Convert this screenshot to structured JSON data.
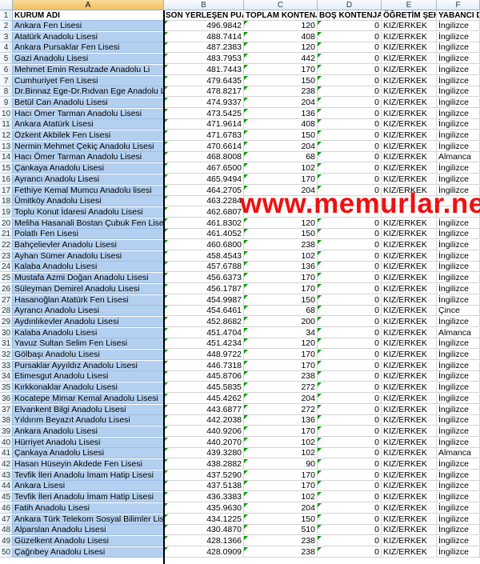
{
  "columns": [
    "A",
    "B",
    "C",
    "D",
    "E",
    "F"
  ],
  "headers": [
    "KURUM ADI",
    "SON YERLEŞEN PUANI",
    "TOPLAM KONTENJAN",
    "BOŞ KONTENJAN",
    "ÖĞRETİM ŞEKLİ",
    "YABANCI DİL"
  ],
  "watermark": "www.memurlar.net",
  "rows": [
    {
      "n": "2",
      "name": "Ankara Fen Lisesi",
      "puan": "496.9842",
      "toplam": "120",
      "bos": "0",
      "sekil": "KIZ/ERKEK",
      "dil": "İngilizce"
    },
    {
      "n": "3",
      "name": "Atatürk Anadolu Lisesi",
      "puan": "488.7414",
      "toplam": "408",
      "bos": "0",
      "sekil": "KIZ/ERKEK",
      "dil": "İngilizce"
    },
    {
      "n": "4",
      "name": "Ankara Pursaklar Fen Lisesi",
      "puan": "487.2383",
      "toplam": "120",
      "bos": "0",
      "sekil": "KIZ/ERKEK",
      "dil": "İngilizce"
    },
    {
      "n": "5",
      "name": "Gazi Anadolu Lisesi",
      "puan": "483.7953",
      "toplam": "442",
      "bos": "0",
      "sekil": "KIZ/ERKEK",
      "dil": "İngilizce"
    },
    {
      "n": "6",
      "name": "Mehmet Emin Resulzade Anadolu Li",
      "puan": "481.7443",
      "toplam": "170",
      "bos": "0",
      "sekil": "KIZ/ERKEK",
      "dil": "İngilizce"
    },
    {
      "n": "7",
      "name": "Cumhuriyet Fen Lisesi",
      "puan": "479.6435",
      "toplam": "150",
      "bos": "0",
      "sekil": "KIZ/ERKEK",
      "dil": "İngilizce"
    },
    {
      "n": "8",
      "name": "Dr.Binnaz Ege-Dr.Rıdvan Ege Anadolu Lis",
      "puan": "478.8217",
      "toplam": "238",
      "bos": "0",
      "sekil": "KIZ/ERKEK",
      "dil": "İngilizce"
    },
    {
      "n": "9",
      "name": "Betül Can Anadolu Lisesi",
      "puan": "474.9337",
      "toplam": "204",
      "bos": "0",
      "sekil": "KIZ/ERKEK",
      "dil": "İngilizce"
    },
    {
      "n": "10",
      "name": "Hacı Ömer Tarman Anadolu Lisesi",
      "puan": "473.5425",
      "toplam": "136",
      "bos": "0",
      "sekil": "KIZ/ERKEK",
      "dil": "İngilizce"
    },
    {
      "n": "11",
      "name": "Ankara Atatürk Lisesi",
      "puan": "471.9614",
      "toplam": "408",
      "bos": "0",
      "sekil": "KIZ/ERKEK",
      "dil": "İngilizce"
    },
    {
      "n": "12",
      "name": "Özkent Akbilek Fen Lisesi",
      "puan": "471.6783",
      "toplam": "150",
      "bos": "0",
      "sekil": "KIZ/ERKEK",
      "dil": "İngilizce"
    },
    {
      "n": "13",
      "name": "Nermin Mehmet Çekiç Anadolu Lisesi",
      "puan": "470.6614",
      "toplam": "204",
      "bos": "0",
      "sekil": "KIZ/ERKEK",
      "dil": "İngilizce"
    },
    {
      "n": "14",
      "name": "Hacı Ömer Tarman Anadolu Lisesi",
      "puan": "468.8008",
      "toplam": "68",
      "bos": "0",
      "sekil": "KIZ/ERKEK",
      "dil": "Almanca"
    },
    {
      "n": "15",
      "name": "Çankaya Anadolu Lisesi",
      "puan": "467.6500",
      "toplam": "102",
      "bos": "0",
      "sekil": "KIZ/ERKEK",
      "dil": "İngilizce"
    },
    {
      "n": "16",
      "name": "Ayrancı Anadolu Lisesi",
      "puan": "465.9494",
      "toplam": "170",
      "bos": "0",
      "sekil": "KIZ/ERKEK",
      "dil": "İngilizce"
    },
    {
      "n": "17",
      "name": "Fethiye Kemal Mumcu Anadolu lisesi",
      "puan": "464.2705",
      "toplam": "204",
      "bos": "0",
      "sekil": "KIZ/ERKEK",
      "dil": "İngilizce"
    },
    {
      "n": "18",
      "name": "Ümitköy Anadolu Lisesi",
      "puan": "463.2284",
      "toplam": "",
      "bos": "",
      "sekil": "",
      "dil": ""
    },
    {
      "n": "19",
      "name": "Toplu Konut İdaresi Anadolu Lisesi",
      "puan": "462.6807",
      "toplam": "",
      "bos": "",
      "sekil": "",
      "dil": ""
    },
    {
      "n": "20",
      "name": "Meliha Hasanali Bostan Çubuk Fen Lise",
      "puan": "461.8302",
      "toplam": "120",
      "bos": "0",
      "sekil": "KIZ/ERKEK",
      "dil": "İngilizce"
    },
    {
      "n": "21",
      "name": "Polatlı Fen Lisesi",
      "puan": "461.4052",
      "toplam": "150",
      "bos": "0",
      "sekil": "KIZ/ERKEK",
      "dil": "İngilizce"
    },
    {
      "n": "22",
      "name": "Bahçelievler Anadolu Lisesi",
      "puan": "460.6800",
      "toplam": "238",
      "bos": "0",
      "sekil": "KIZ/ERKEK",
      "dil": "İngilizce"
    },
    {
      "n": "23",
      "name": "Ayhan Sümer Anadolu Lisesi",
      "puan": "458.4543",
      "toplam": "102",
      "bos": "0",
      "sekil": "KIZ/ERKEK",
      "dil": "İngilizce"
    },
    {
      "n": "24",
      "name": "Kalaba Anadolu Lisesi",
      "puan": "457.6788",
      "toplam": "136",
      "bos": "0",
      "sekil": "KIZ/ERKEK",
      "dil": "İngilizce"
    },
    {
      "n": "25",
      "name": "Mustafa Azmi Doğan Anadolu Lisesi",
      "puan": "456.6373",
      "toplam": "170",
      "bos": "0",
      "sekil": "KIZ/ERKEK",
      "dil": "İngilizce"
    },
    {
      "n": "26",
      "name": "Süleyman Demirel Anadolu Lisesi",
      "puan": "456.1787",
      "toplam": "170",
      "bos": "0",
      "sekil": "KIZ/ERKEK",
      "dil": "İngilizce"
    },
    {
      "n": "27",
      "name": "Hasanoğlan Atatürk Fen Lisesi",
      "puan": "454.9987",
      "toplam": "150",
      "bos": "0",
      "sekil": "KIZ/ERKEK",
      "dil": "İngilizce"
    },
    {
      "n": "28",
      "name": "Ayrancı Anadolu Lisesi",
      "puan": "454.6461",
      "toplam": "68",
      "bos": "0",
      "sekil": "KIZ/ERKEK",
      "dil": "Çince"
    },
    {
      "n": "29",
      "name": "Aydınlıkevler Anadolu Lisesi",
      "puan": "452.8682",
      "toplam": "200",
      "bos": "0",
      "sekil": "KIZ/ERKEK",
      "dil": "İngilizce"
    },
    {
      "n": "30",
      "name": "Kalaba Anadolu Lisesi",
      "puan": "451.4704",
      "toplam": "34",
      "bos": "0",
      "sekil": "KIZ/ERKEK",
      "dil": "Almanca"
    },
    {
      "n": "31",
      "name": "Yavuz Sultan Selim Fen Lisesi",
      "puan": "451.4234",
      "toplam": "120",
      "bos": "0",
      "sekil": "KIZ/ERKEK",
      "dil": "İngilizce"
    },
    {
      "n": "32",
      "name": "Gölbaşı Anadolu Lisesi",
      "puan": "448.9722",
      "toplam": "170",
      "bos": "0",
      "sekil": "KIZ/ERKEK",
      "dil": "İngilizce"
    },
    {
      "n": "33",
      "name": "Pursaklar Ayyıldız Anadolu Lisesi",
      "puan": "446.7318",
      "toplam": "170",
      "bos": "0",
      "sekil": "KIZ/ERKEK",
      "dil": "İngilizce"
    },
    {
      "n": "34",
      "name": "Etimesgut Anadolu Lisesi",
      "puan": "445.8706",
      "toplam": "238",
      "bos": "0",
      "sekil": "KIZ/ERKEK",
      "dil": "İngilizce"
    },
    {
      "n": "35",
      "name": "Kırkkonaklar Anadolu Lisesi",
      "puan": "445.5835",
      "toplam": "272",
      "bos": "0",
      "sekil": "KIZ/ERKEK",
      "dil": "İngilizce"
    },
    {
      "n": "36",
      "name": "Kocatepe Mimar Kemal Anadolu Lisesi",
      "puan": "445.4262",
      "toplam": "204",
      "bos": "0",
      "sekil": "KIZ/ERKEK",
      "dil": "İngilizce"
    },
    {
      "n": "37",
      "name": "Elvankent Bilgi Anadolu Lisesi",
      "puan": "443.6877",
      "toplam": "272",
      "bos": "0",
      "sekil": "KIZ/ERKEK",
      "dil": "İngilizce"
    },
    {
      "n": "38",
      "name": "Yıldırım Beyazıt Anadolu Lisesi",
      "puan": "442.2038",
      "toplam": "136",
      "bos": "0",
      "sekil": "KIZ/ERKEK",
      "dil": "İngilizce"
    },
    {
      "n": "39",
      "name": "Ankara Anadolu Lisesi",
      "puan": "440.9206",
      "toplam": "170",
      "bos": "0",
      "sekil": "KIZ/ERKEK",
      "dil": "İngilizce"
    },
    {
      "n": "40",
      "name": "Hürriyet Anadolu Lisesi",
      "puan": "440.2070",
      "toplam": "102",
      "bos": "0",
      "sekil": "KIZ/ERKEK",
      "dil": "İngilizce"
    },
    {
      "n": "41",
      "name": "Çankaya Anadolu Lisesi",
      "puan": "439.3280",
      "toplam": "102",
      "bos": "0",
      "sekil": "KIZ/ERKEK",
      "dil": "Almanca"
    },
    {
      "n": "42",
      "name": "Hasan Hüseyin Akdede Fen Lisesi",
      "puan": "438.2882",
      "toplam": "90",
      "bos": "0",
      "sekil": "KIZ/ERKEK",
      "dil": "İngilizce"
    },
    {
      "n": "43",
      "name": "Tevfik İleri Anadolu İmam Hatip Lisesi",
      "puan": "437.5290",
      "toplam": "170",
      "bos": "0",
      "sekil": "KIZ/ERKEK",
      "dil": "İngilizce"
    },
    {
      "n": "44",
      "name": "Ankara Lisesi",
      "puan": "437.5138",
      "toplam": "170",
      "bos": "0",
      "sekil": "KIZ/ERKEK",
      "dil": "İngilizce"
    },
    {
      "n": "45",
      "name": "Tevfik İleri Anadolu İmam Hatip Lisesi",
      "puan": "436.3383",
      "toplam": "102",
      "bos": "0",
      "sekil": "KIZ/ERKEK",
      "dil": "İngilizce"
    },
    {
      "n": "46",
      "name": "Fatih Anadolu Lisesi",
      "puan": "435.9630",
      "toplam": "204",
      "bos": "0",
      "sekil": "KIZ/ERKEK",
      "dil": "İngilizce"
    },
    {
      "n": "47",
      "name": "Ankara Türk Telekom Sosyal Bilimler Lis",
      "puan": "434.1225",
      "toplam": "150",
      "bos": "0",
      "sekil": "KIZ/ERKEK",
      "dil": "İngilizce"
    },
    {
      "n": "48",
      "name": "Alparslan Anadolu Lisesi",
      "puan": "430.4870",
      "toplam": "510",
      "bos": "0",
      "sekil": "KIZ/ERKEK",
      "dil": "İngilizce"
    },
    {
      "n": "49",
      "name": "Güzelkent Anadolu Lisesi",
      "puan": "428.1366",
      "toplam": "238",
      "bos": "0",
      "sekil": "KIZ/ERKEK",
      "dil": "İngilizce"
    },
    {
      "n": "50",
      "name": "Çağrıbey Anadolu Lisesi",
      "puan": "428.0909",
      "toplam": "238",
      "bos": "0",
      "sekil": "KIZ/ERKEK",
      "dil": "İngilizce"
    }
  ]
}
